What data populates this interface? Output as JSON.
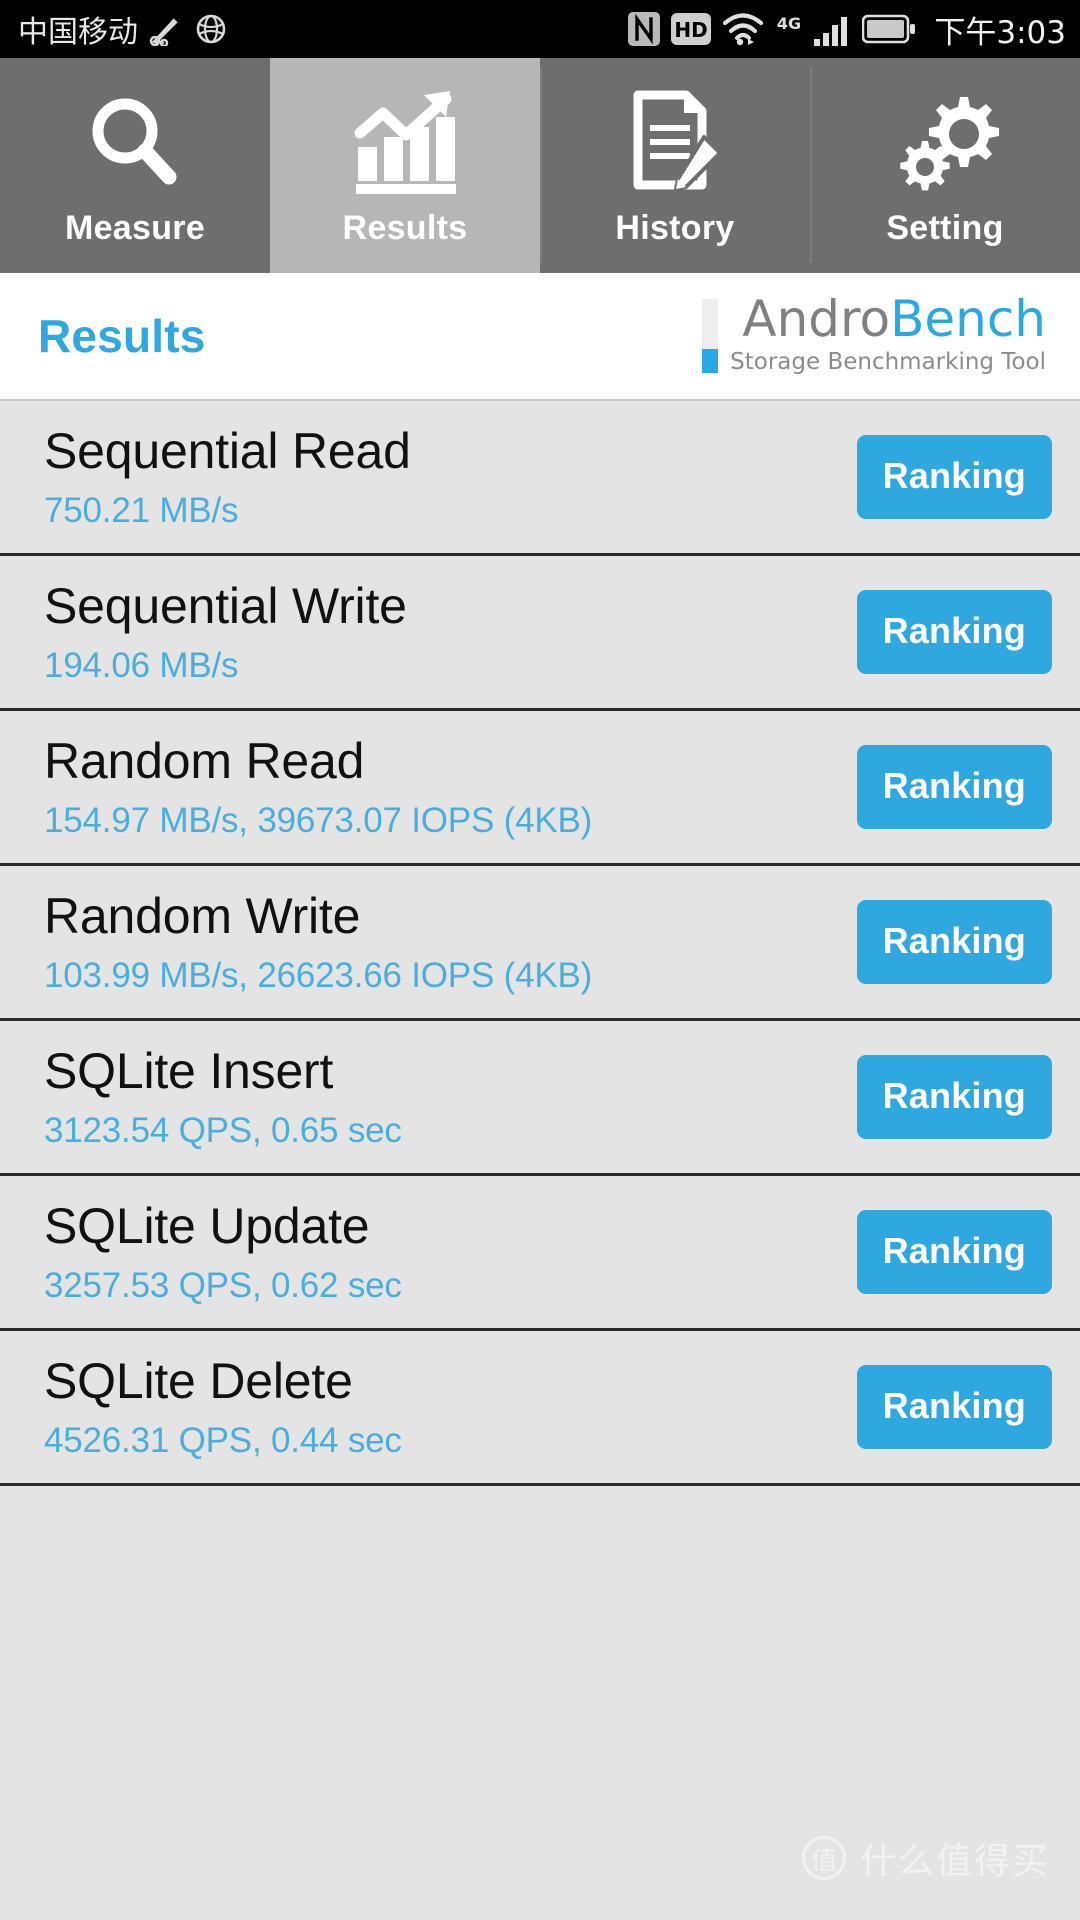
{
  "status_bar": {
    "carrier": "中国移动",
    "time": "下午3:03",
    "icons": [
      "satellite-dish-icon",
      "globe-icon",
      "nfc-icon",
      "hd-icon",
      "wifi-icon",
      "4g-icon",
      "signal-bars-icon",
      "battery-icon"
    ],
    "network_label": "4G",
    "hd_label": "HD"
  },
  "tabs": [
    {
      "label": "Measure",
      "icon": "magnifier-icon",
      "active": false
    },
    {
      "label": "Results",
      "icon": "bar-chart-trend-icon",
      "active": true
    },
    {
      "label": "History",
      "icon": "document-pencil-icon",
      "active": false
    },
    {
      "label": "Setting",
      "icon": "gears-icon",
      "active": false
    }
  ],
  "header": {
    "title": "Results",
    "logo_part1": "Andro",
    "logo_part2": "Bench",
    "logo_subtitle": "Storage Benchmarking Tool"
  },
  "colors": {
    "accent": "#2fa8e0",
    "value_text": "#4aaedd",
    "tab_inactive_bg": "#6e6e6e",
    "tab_active_bg": "#b6b6b6",
    "list_bg": "#e4e4e4",
    "logo_gray": "#808080"
  },
  "results": [
    {
      "title": "Sequential Read",
      "value": "750.21 MB/s",
      "action": "Ranking"
    },
    {
      "title": "Sequential Write",
      "value": "194.06 MB/s",
      "action": "Ranking"
    },
    {
      "title": "Random Read",
      "value": "154.97 MB/s, 39673.07 IOPS (4KB)",
      "action": "Ranking"
    },
    {
      "title": "Random Write",
      "value": "103.99 MB/s, 26623.66 IOPS (4KB)",
      "action": "Ranking"
    },
    {
      "title": "SQLite Insert",
      "value": "3123.54 QPS, 0.65 sec",
      "action": "Ranking"
    },
    {
      "title": "SQLite Update",
      "value": "3257.53 QPS, 0.62 sec",
      "action": "Ranking"
    },
    {
      "title": "SQLite Delete",
      "value": "4526.31 QPS, 0.44 sec",
      "action": "Ranking"
    }
  ],
  "watermark": {
    "mark": "值",
    "text": "什么值得买"
  }
}
